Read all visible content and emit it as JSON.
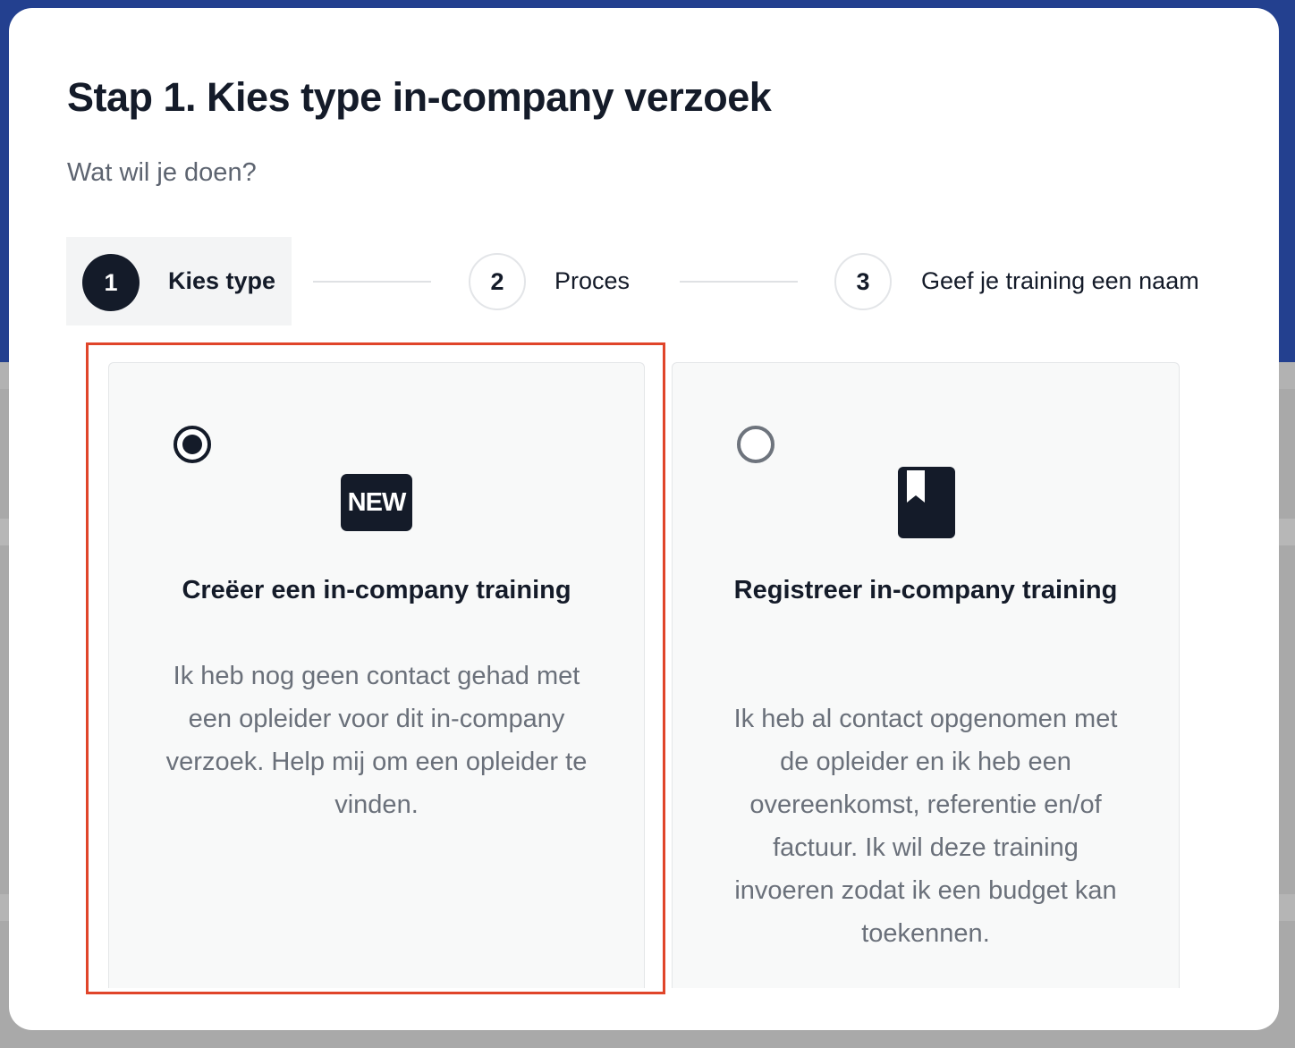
{
  "modal": {
    "title": "Stap 1. Kies type in-company verzoek",
    "subtitle": "Wat wil je doen?"
  },
  "stepper": {
    "steps": [
      {
        "number": "1",
        "label": "Kies type",
        "active": true
      },
      {
        "number": "2",
        "label": "Proces",
        "active": false
      },
      {
        "number": "3",
        "label": "Geef je training een naam",
        "active": false
      }
    ]
  },
  "options": [
    {
      "selected": true,
      "icon": "new-badge-icon",
      "badge_text": "NEW",
      "title": "Creëer een in-company training",
      "description": "Ik heb nog geen contact gehad met een opleider voor dit in-company verzoek. Help mij om een opleider te vinden."
    },
    {
      "selected": false,
      "icon": "bookmark-book-icon",
      "title": "Registreer in-company training",
      "description": "Ik heb al contact opgenomen met de opleider en ik heb een overeenkomst, referentie en/of factuur. Ik wil deze training invoeren zodat ik een budget kan toekennen."
    }
  ],
  "colors": {
    "primary": "#141b29",
    "highlight": "#e0452a",
    "card_bg": "#f8f9f9",
    "muted_text": "#6a707a",
    "backdrop_header": "#23408f"
  }
}
